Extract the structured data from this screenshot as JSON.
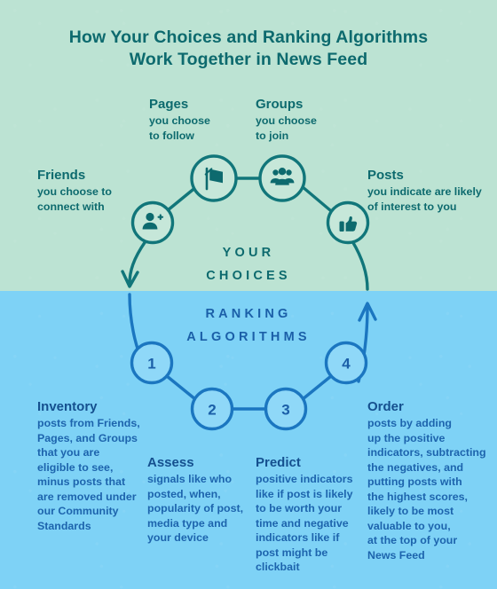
{
  "title": {
    "line1": "How Your Choices and Ranking Algorithms",
    "line2": "Work Together in News Feed"
  },
  "colors": {
    "bg_top": "#bce3d3",
    "bg_bottom": "#7ed2f6",
    "teal_text": "#0d6a6e",
    "blue_text": "#1b5fa8",
    "teal_stroke": "#11767a",
    "blue_stroke": "#1b76c0"
  },
  "center": {
    "choices_line1": "YOUR",
    "choices_line2": "CHOICES",
    "ranking_line1": "RANKING",
    "ranking_line2": "ALGORITHMS"
  },
  "choices": [
    {
      "id": "friends",
      "head": "Friends",
      "body": "you choose to\nconnect with",
      "icon": "person-add-icon"
    },
    {
      "id": "pages",
      "head": "Pages",
      "body": "you choose\nto follow",
      "icon": "flag-icon"
    },
    {
      "id": "groups",
      "head": "Groups",
      "body": "you choose\nto join",
      "icon": "people-group-icon"
    },
    {
      "id": "posts",
      "head": "Posts",
      "body": "you indicate are likely\nof interest to you",
      "icon": "thumbs-up-icon"
    }
  ],
  "steps": [
    {
      "number": "1",
      "head": "Inventory",
      "body": "posts from Friends,\nPages, and Groups\nthat you are\neligible to see,\nminus posts that\nare removed under\nour Community\nStandards"
    },
    {
      "number": "2",
      "head": "Assess",
      "body": "signals like who\nposted, when,\npopularity of post,\nmedia type and\nyour device"
    },
    {
      "number": "3",
      "head": "Predict",
      "body": "positive indicators\nlike if post is likely\nto be worth your\ntime and negative\nindicators like if\npost might be\nclickbait"
    },
    {
      "number": "4",
      "head": "Order",
      "body": "posts by adding\nup the positive\nindicators, subtracting\nthe negatives, and\nputting posts with\nthe highest scores,\nlikely to be most\nvaluable to you,\nat the top of your\nNews Feed"
    }
  ]
}
